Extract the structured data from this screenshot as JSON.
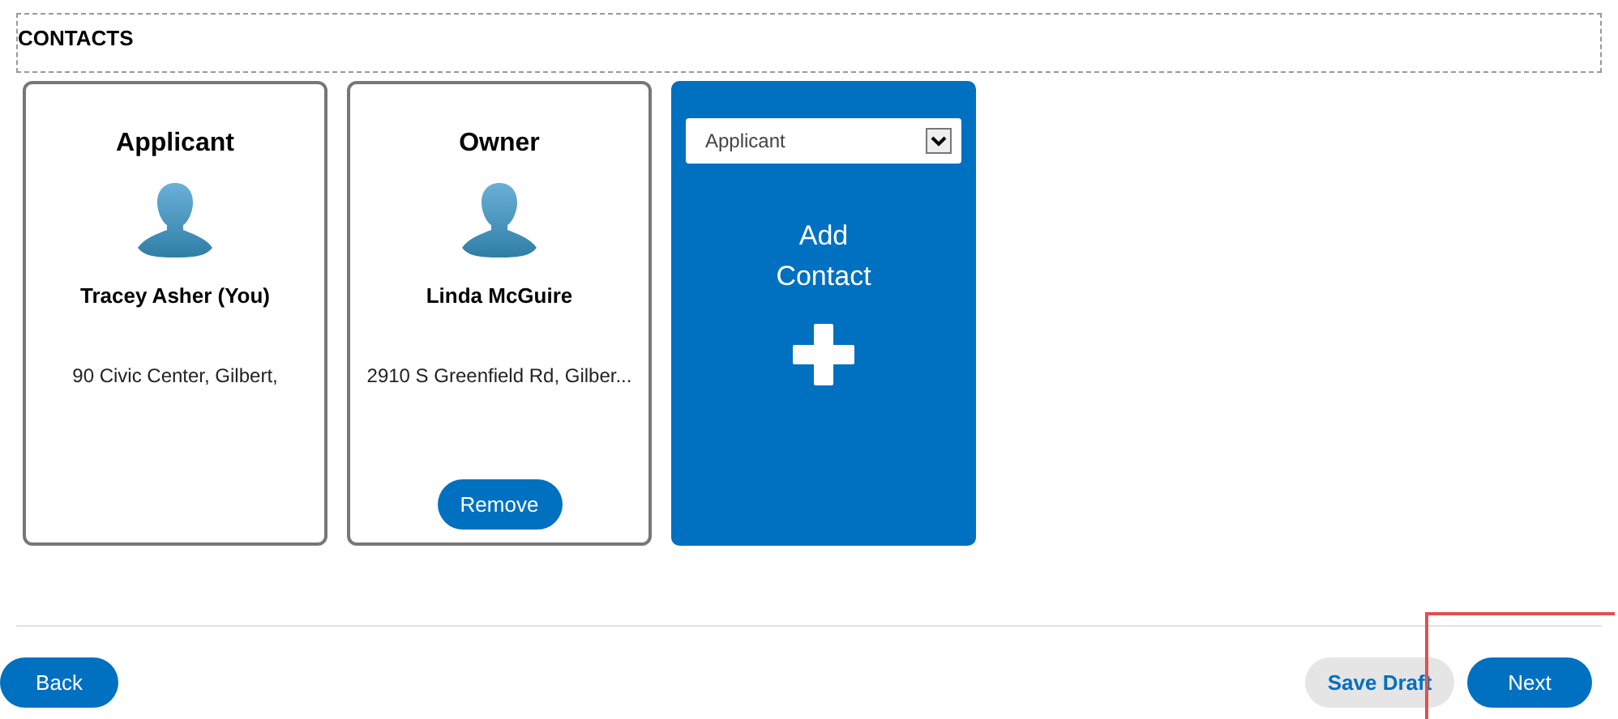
{
  "section": {
    "title": "CONTACTS"
  },
  "cards": [
    {
      "kind": "contact",
      "role": "Applicant",
      "name": "Tracey Asher (You)",
      "address": "90 Civic Center, Gilbert,"
    },
    {
      "kind": "contact",
      "role": "Owner",
      "name": "Linda McGuire",
      "address": "2910 S Greenfield Rd, Gilber...",
      "action": "Remove"
    },
    {
      "kind": "add",
      "select_value": "Applicant",
      "label": "Add Contact"
    }
  ],
  "footer": {
    "back": "Back",
    "save_draft": "Save Draft",
    "next": "Next"
  }
}
